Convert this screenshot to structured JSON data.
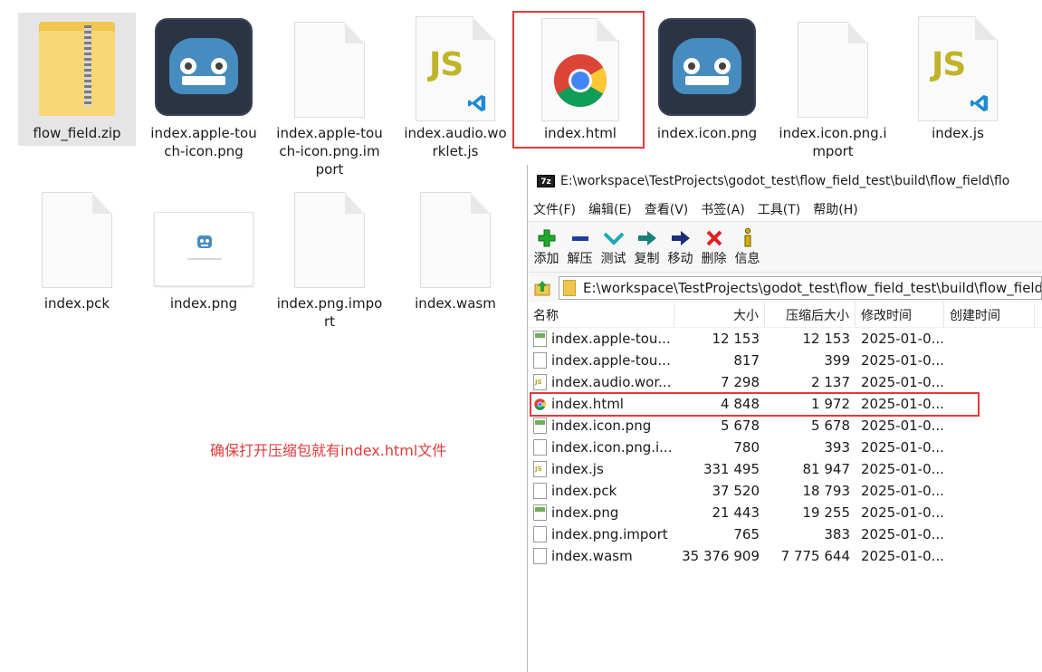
{
  "explorer": {
    "files": [
      {
        "name": "flow_field.zip",
        "icon": "zip-folder-icon"
      },
      {
        "name": "index.apple-touch-icon.png",
        "icon": "godot-icon"
      },
      {
        "name": "index.apple-touch-icon.png.import",
        "icon": "blank-file-icon"
      },
      {
        "name": "index.audio.worklet.js",
        "icon": "js-file-icon"
      },
      {
        "name": "index.html",
        "icon": "chrome-icon"
      },
      {
        "name": "index.icon.png",
        "icon": "godot-icon"
      },
      {
        "name": "index.icon.png.import",
        "icon": "blank-file-icon"
      },
      {
        "name": "index.js",
        "icon": "js-file-icon"
      },
      {
        "name": "index.pck",
        "icon": "blank-file-icon"
      },
      {
        "name": "index.png",
        "icon": "png-preview-icon"
      },
      {
        "name": "index.png.import",
        "icon": "blank-file-icon"
      },
      {
        "name": "index.wasm",
        "icon": "blank-file-icon"
      }
    ],
    "name_lines": {
      "f0": [
        "flow_field.zip"
      ],
      "f1": [
        "index.apple-tou",
        "ch-icon.png"
      ],
      "f2": [
        "index.apple-tou",
        "ch-icon.png.im",
        "port"
      ],
      "f3": [
        "index.audio.wo",
        "rklet.js"
      ],
      "f4": [
        "index.html"
      ],
      "f5": [
        "index.icon.png"
      ],
      "f6": [
        "index.icon.png.i",
        "mport"
      ],
      "f7": [
        "index.js"
      ],
      "f8": [
        "index.pck"
      ],
      "f9": [
        "index.png"
      ],
      "f10": [
        "index.png.impo",
        "rt"
      ],
      "f11": [
        "index.wasm"
      ]
    }
  },
  "annotation": "确保打开压缩包就有index.html文件",
  "sevenzip": {
    "title": "E:\\workspace\\TestProjects\\godot_test\\flow_field_test\\build\\flow_field\\flo",
    "app_icon_text": "7z",
    "menu": [
      "文件(F)",
      "编辑(E)",
      "查看(V)",
      "书签(A)",
      "工具(T)",
      "帮助(H)"
    ],
    "toolbar": [
      {
        "label": "添加",
        "icon": "add-icon",
        "color": "#1faa2b"
      },
      {
        "label": "解压",
        "icon": "extract-icon",
        "color": "#1c3f9e"
      },
      {
        "label": "测试",
        "icon": "test-icon",
        "color": "#1eaab2"
      },
      {
        "label": "复制",
        "icon": "copy-icon",
        "color": "#1d7e7e"
      },
      {
        "label": "移动",
        "icon": "move-icon",
        "color": "#1c2f7a"
      },
      {
        "label": "删除",
        "icon": "delete-icon",
        "color": "#e32020"
      },
      {
        "label": "信息",
        "icon": "info-icon",
        "color": "#d4b000"
      }
    ],
    "address": "E:\\workspace\\TestProjects\\godot_test\\flow_field_test\\build\\flow_field",
    "columns": {
      "name": "名称",
      "size": "大小",
      "packed": "压缩后大小",
      "modified": "修改时间",
      "created": "创建时间"
    },
    "rows": [
      {
        "name": "index.apple-tou...",
        "size": "12 153",
        "packed": "12 153",
        "modified": "2025-01-0...",
        "type": "img"
      },
      {
        "name": "index.apple-tou...",
        "size": "817",
        "packed": "399",
        "modified": "2025-01-0...",
        "type": "plain"
      },
      {
        "name": "index.audio.wor...",
        "size": "7 298",
        "packed": "2 137",
        "modified": "2025-01-0...",
        "type": "js"
      },
      {
        "name": "index.html",
        "size": "4 848",
        "packed": "1 972",
        "modified": "2025-01-0...",
        "type": "html"
      },
      {
        "name": "index.icon.png",
        "size": "5 678",
        "packed": "5 678",
        "modified": "2025-01-0...",
        "type": "img"
      },
      {
        "name": "index.icon.png.i...",
        "size": "780",
        "packed": "393",
        "modified": "2025-01-0...",
        "type": "plain"
      },
      {
        "name": "index.js",
        "size": "331 495",
        "packed": "81 947",
        "modified": "2025-01-0...",
        "type": "js"
      },
      {
        "name": "index.pck",
        "size": "37 520",
        "packed": "18 793",
        "modified": "2025-01-0...",
        "type": "plain"
      },
      {
        "name": "index.png",
        "size": "21 443",
        "packed": "19 255",
        "modified": "2025-01-0...",
        "type": "img"
      },
      {
        "name": "index.png.import",
        "size": "765",
        "packed": "383",
        "modified": "2025-01-0...",
        "type": "plain"
      },
      {
        "name": "index.wasm",
        "size": "35 376 909",
        "packed": "7 775 644",
        "modified": "2025-01-0...",
        "type": "plain"
      }
    ]
  },
  "colors": {
    "highlight_red": "#e03b3b",
    "godot_blue": "#478cbf",
    "zip_yellow": "#f8d774"
  }
}
